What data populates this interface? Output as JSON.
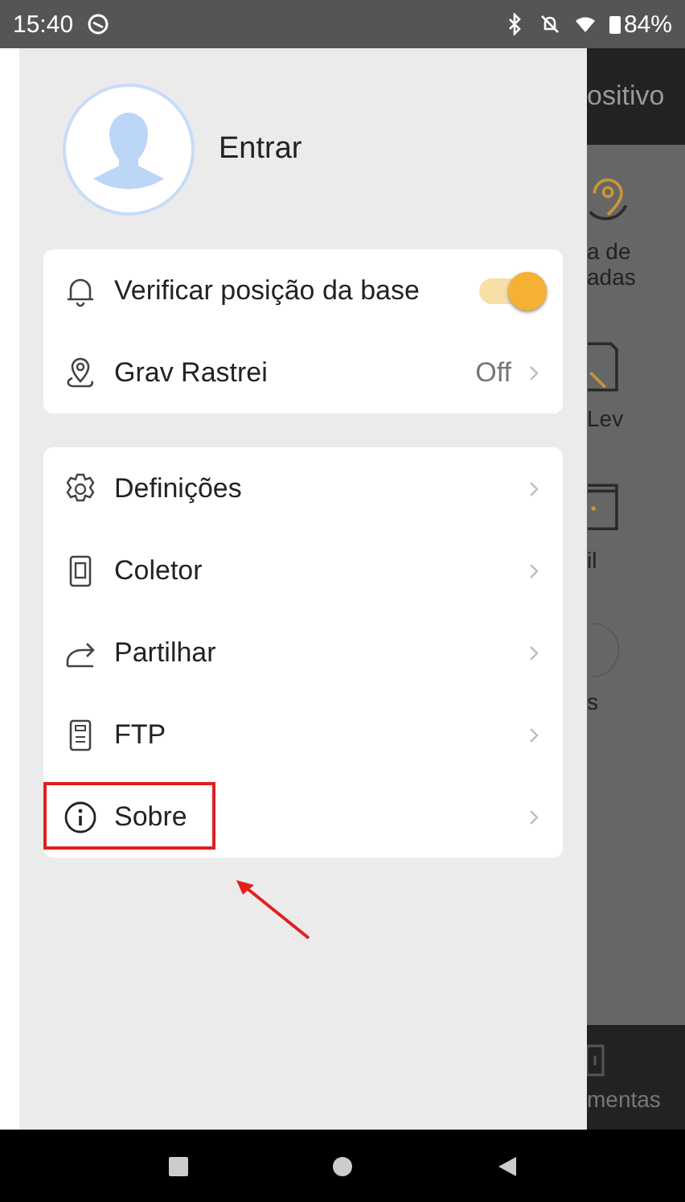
{
  "status_bar": {
    "time": "15:40",
    "battery": "84%"
  },
  "drawer": {
    "login": "Entrar",
    "card_1": [
      {
        "kind": "toggle",
        "label": "Verificar posição da base",
        "on": true
      },
      {
        "kind": "value",
        "label": "Grav Rastrei",
        "value": "Off"
      }
    ],
    "card_2": [
      {
        "label": "Definições",
        "highlighted": false
      },
      {
        "label": "Coletor",
        "highlighted": false
      },
      {
        "label": "Partilhar",
        "highlighted": false
      },
      {
        "label": "FTP",
        "highlighted": false
      },
      {
        "label": "Sobre",
        "highlighted": true
      }
    ]
  },
  "background": {
    "header": "ositivo",
    "labels": [
      "a de",
      "adas",
      "Lev",
      "il",
      "s"
    ],
    "bottom_tab": "mentas"
  }
}
